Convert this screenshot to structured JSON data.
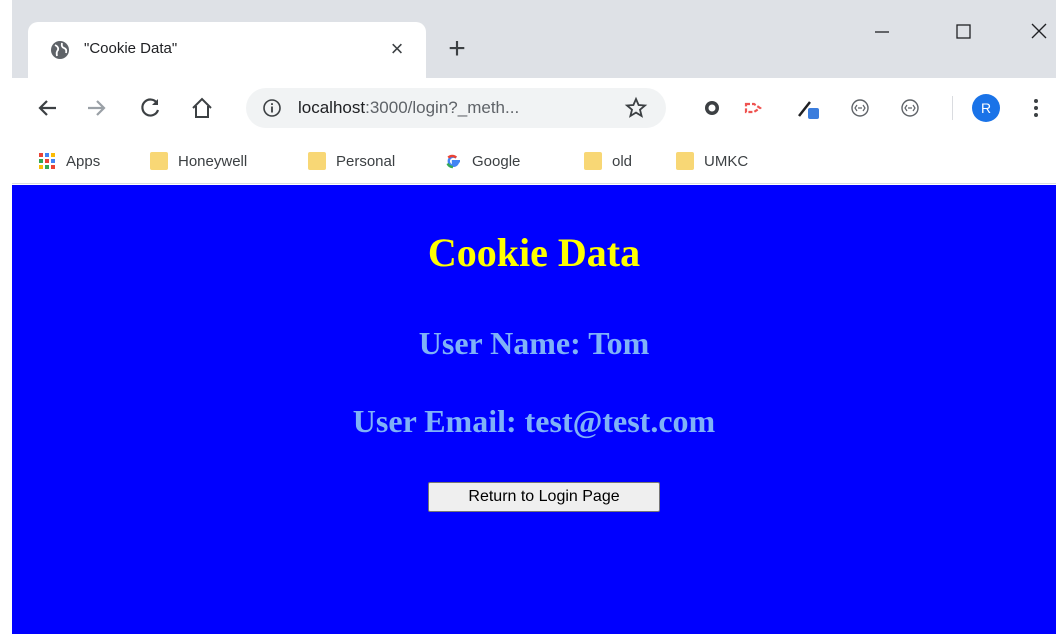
{
  "tab": {
    "title": "\"Cookie Data\""
  },
  "toolbar": {
    "url_host": "localhost",
    "url_rest": ":3000/login?_meth..."
  },
  "bookmarks": [
    {
      "label": "Apps"
    },
    {
      "label": "Honeywell"
    },
    {
      "label": "Personal"
    },
    {
      "label": "Google"
    },
    {
      "label": "old"
    },
    {
      "label": "UMKC"
    }
  ],
  "profile": {
    "initial": "R"
  },
  "page": {
    "heading": "Cookie Data",
    "user_name": "User Name: Tom",
    "user_email": "User Email: test@test.com",
    "return_button": "Return to Login Page"
  },
  "colors": {
    "page_bg": "#0000ff",
    "heading": "#ffff00",
    "subheading": "#7fb2f7"
  }
}
